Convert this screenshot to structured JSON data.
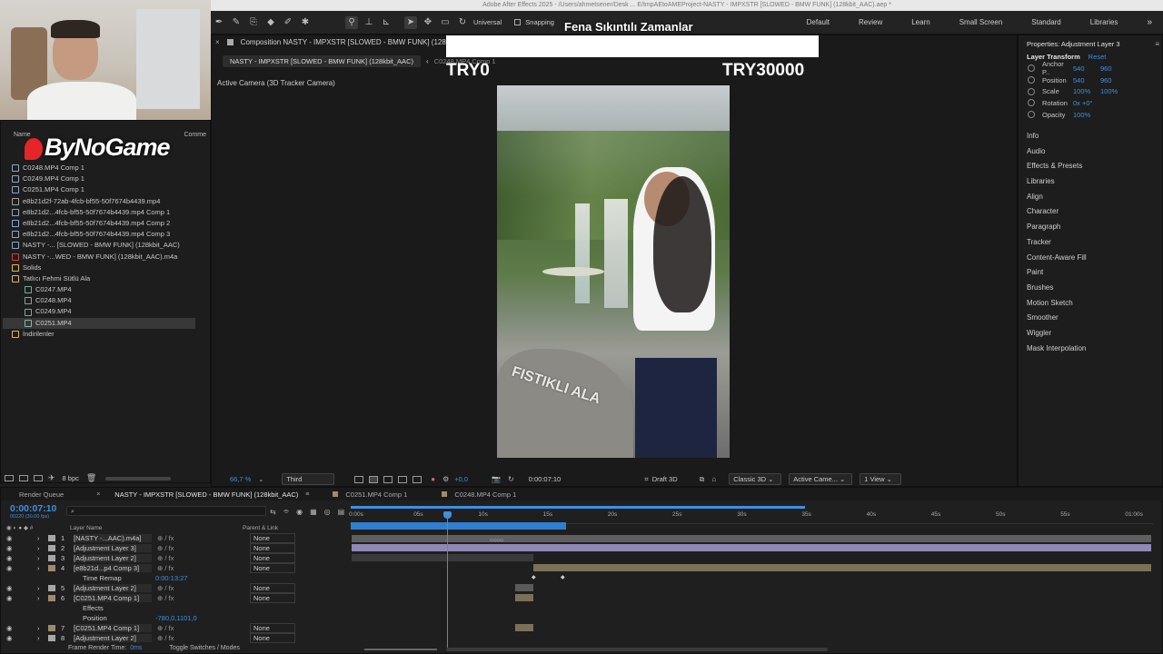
{
  "window_title": "Adobe After Effects 2025 - /Users/ahmetsener/Desk ... E/tmpAEtoAMEProject-NASTY - IMPXSTR [SLOWED - BMW FUNK] (128kbit_AAC).aep *",
  "toolbar": {
    "universal": "Universal",
    "snapping": "Snapping"
  },
  "workspaces": [
    "Default",
    "Review",
    "Learn",
    "Small Screen",
    "Standard",
    "Libraries"
  ],
  "overlay": {
    "headline": "Fena Sıkıntılı Zamanlar",
    "left_value": "TRY0",
    "right_value": "TRY30000",
    "watermark": "ByNoGame"
  },
  "project": {
    "col_name": "Name",
    "col_comment": "Comme",
    "items": [
      {
        "label": "C0248.MP4 Comp 1",
        "indent": 0,
        "color": "#8fa8c0"
      },
      {
        "label": "C0249.MP4 Comp 1",
        "indent": 0,
        "color": "#8fa8c0"
      },
      {
        "label": "C0251.MP4 Comp 1",
        "indent": 0,
        "color": "#8fa8c0"
      },
      {
        "label": "e8b21d2f-72ab-4fcb-bf55-50f7674b4439.mp4",
        "indent": 0,
        "color": "#a0a0a0"
      },
      {
        "label": "e8b21d2...4fcb-bf55-50f7674b4439.mp4 Comp 1",
        "indent": 0,
        "color": "#8fa8c0"
      },
      {
        "label": "e8b21d2...4fcb-bf55-50f7674b4439.mp4 Comp 2",
        "indent": 0,
        "color": "#8fa8c0"
      },
      {
        "label": "e8b21d2...4fcb-bf55-50f7674b4439.mp4 Comp 3",
        "indent": 0,
        "color": "#8fa8c0"
      },
      {
        "label": "NASTY -... [SLOWED - BMW FUNK] (128kbit_AAC)",
        "indent": 0,
        "color": "#8fa8c0"
      },
      {
        "label": "NASTY -...WED - BMW FUNK] (128kbit_AAC).m4a",
        "indent": 0,
        "color": "#d04040"
      },
      {
        "label": "Solids",
        "indent": 0,
        "color": "#d9b860"
      },
      {
        "label": "Tatlıcı Fehmi Sütlü Ala",
        "indent": 0,
        "color": "#d9b860"
      },
      {
        "label": "C0247.MP4",
        "indent": 1,
        "color": "#6fb0a0"
      },
      {
        "label": "C0248.MP4",
        "indent": 1,
        "color": "#6fb0a0"
      },
      {
        "label": "C0249.MP4",
        "indent": 1,
        "color": "#6fb0a0"
      },
      {
        "label": "C0251.MP4",
        "indent": 1,
        "color": "#6fb0a0"
      },
      {
        "label": "İndirilenler",
        "indent": 0,
        "color": "#d9b860"
      }
    ],
    "bpc": "8 bpc"
  },
  "composition": {
    "panel_title": "Composition NASTY - IMPXSTR [SLOWED - BMW FUNK] (128",
    "tab_active": "NASTY - IMPXSTR [SLOWED - BMW FUNK] (128kbit_AAC)",
    "tab_other": "C0248.MP4 Comp 1",
    "camera_label": "Active Camera (3D Tracker Camera)",
    "image_text": "FISTIKLI ALA",
    "zoom": "66,7 %",
    "resolution": "Third",
    "exposure": "+0,0",
    "timecode": "0:00:07:10",
    "renderer": "Draft 3D",
    "mode": "Classic 3D",
    "camera": "Active Came...",
    "views": "1 View"
  },
  "properties": {
    "title": "Properties: Adjustment Layer 3",
    "section": "Layer Transform",
    "reset": "Reset",
    "rows": [
      {
        "label": "Anchor P..",
        "v1": "540",
        "v2": "960"
      },
      {
        "label": "Position",
        "v1": "540",
        "v2": "960"
      },
      {
        "label": "Scale",
        "v1": "100%",
        "v2": "100%"
      },
      {
        "label": "Rotation",
        "v1": "0x +0°",
        "v2": ""
      },
      {
        "label": "Opacity",
        "v1": "100%",
        "v2": ""
      }
    ]
  },
  "right_panels": [
    "Info",
    "Audio",
    "Effects & Presets",
    "Libraries",
    "Align",
    "Character",
    "Paragraph",
    "Tracker",
    "Content-Aware Fill",
    "Paint",
    "Brushes",
    "Motion Sketch",
    "Smoother",
    "Wiggler",
    "Mask Interpolation"
  ],
  "timeline": {
    "tabs": [
      "Render Queue",
      "NASTY - IMPXSTR [SLOWED - BMW FUNK] (128kbit_AAC)",
      "C0251.MP4 Comp 1",
      "C0248.MP4 Comp 1"
    ],
    "current_time": "0:00:07:10",
    "frame_info": "00220 (30.00 fps)",
    "col_layer": "Layer Name",
    "col_parent": "Parent & Link",
    "ticks": [
      "0:00s",
      "05s",
      "10s",
      "15s",
      "20s",
      "25s",
      "30s",
      "35s",
      "40s",
      "45s",
      "50s",
      "55s",
      "01:00s"
    ],
    "layers": [
      {
        "num": "1",
        "name": "[NASTY -...AAC).m4a]",
        "parent": "None",
        "color": "#a7a7a7"
      },
      {
        "num": "2",
        "name": "[Adjustment Layer 3]",
        "parent": "None",
        "color": "#a7a7a7"
      },
      {
        "num": "3",
        "name": "[Adjustment Layer 2]",
        "parent": "None",
        "color": "#a7a7a7"
      },
      {
        "num": "4",
        "name": "[e8b21d...p4 Comp 3]",
        "parent": "None",
        "color": "#9c8b6b"
      },
      {
        "num": "",
        "name": "Time Remap",
        "parent": "",
        "value": "0:00:13:27",
        "color": ""
      },
      {
        "num": "5",
        "name": "[Adjustment Layer 2]",
        "parent": "None",
        "color": "#a7a7a7"
      },
      {
        "num": "6",
        "name": "[C0251.MP4 Comp 1]",
        "parent": "None",
        "color": "#9c8b6b"
      },
      {
        "num": "",
        "name": "Effects",
        "parent": "",
        "color": ""
      },
      {
        "num": "",
        "name": "Position",
        "parent": "",
        "value": "-780,0,1101,0",
        "color": ""
      },
      {
        "num": "7",
        "name": "[C0251.MP4 Comp 1]",
        "parent": "None",
        "color": "#9c8b6b"
      },
      {
        "num": "8",
        "name": "[Adjustment Layer 2]",
        "parent": "None",
        "color": "#a7a7a7"
      }
    ],
    "footer_left": "Frame Render Time:",
    "footer_value": "0ms",
    "footer_toggle": "Toggle Switches / Modes"
  },
  "colors": {
    "accent_blue": "#2d8ceb",
    "bar_purple": "#8e88b4",
    "bar_tan": "#7d7058",
    "playhead": "#3f8fe0"
  }
}
